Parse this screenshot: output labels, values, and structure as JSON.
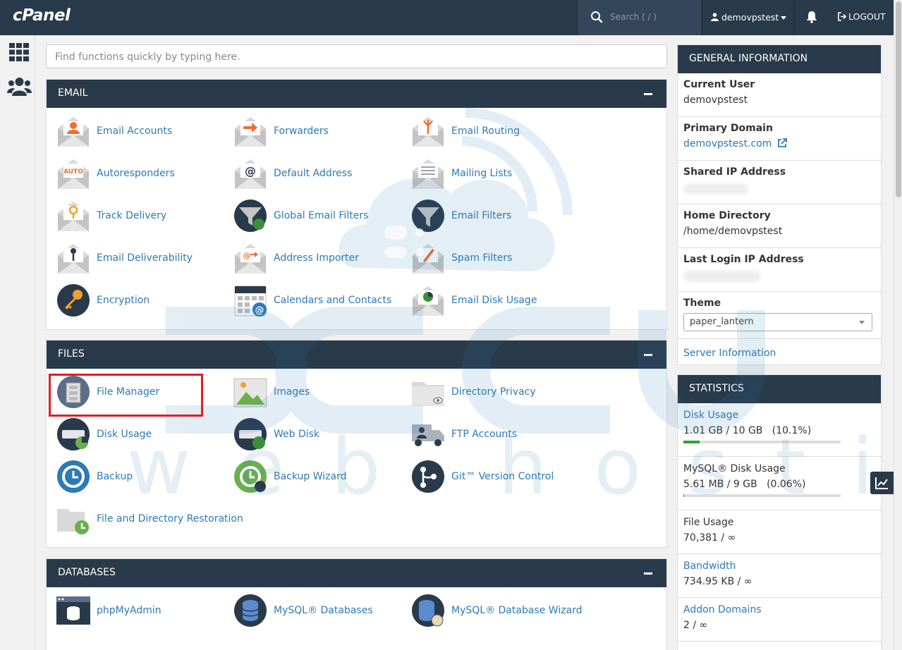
{
  "topbar": {
    "logo": "cPanel",
    "search_placeholder": "Search ( / )",
    "username": "demovpstest",
    "logout": "LOGOUT"
  },
  "quick_search": {
    "placeholder": "Find functions quickly by typing here."
  },
  "sections": {
    "email": {
      "title": "EMAIL",
      "items": [
        {
          "label": "Email Accounts",
          "icon": "email-accounts-icon"
        },
        {
          "label": "Forwarders",
          "icon": "forwarders-icon"
        },
        {
          "label": "Email Routing",
          "icon": "email-routing-icon"
        },
        {
          "label": "Autoresponders",
          "icon": "autoresponders-icon"
        },
        {
          "label": "Default Address",
          "icon": "default-address-icon"
        },
        {
          "label": "Mailing Lists",
          "icon": "mailing-lists-icon"
        },
        {
          "label": "Track Delivery",
          "icon": "track-delivery-icon"
        },
        {
          "label": "Global Email Filters",
          "icon": "global-email-filters-icon"
        },
        {
          "label": "Email Filters",
          "icon": "email-filters-icon"
        },
        {
          "label": "Email Deliverability",
          "icon": "email-deliverability-icon"
        },
        {
          "label": "Address Importer",
          "icon": "address-importer-icon"
        },
        {
          "label": "Spam Filters",
          "icon": "spam-filters-icon"
        },
        {
          "label": "Encryption",
          "icon": "encryption-icon"
        },
        {
          "label": "Calendars and Contacts",
          "icon": "calendars-icon"
        },
        {
          "label": "Email Disk Usage",
          "icon": "email-disk-usage-icon"
        }
      ]
    },
    "files": {
      "title": "FILES",
      "items": [
        {
          "label": "File Manager",
          "icon": "file-manager-icon"
        },
        {
          "label": "Images",
          "icon": "images-icon"
        },
        {
          "label": "Directory Privacy",
          "icon": "directory-privacy-icon"
        },
        {
          "label": "Disk Usage",
          "icon": "disk-usage-icon"
        },
        {
          "label": "Web Disk",
          "icon": "web-disk-icon"
        },
        {
          "label": "FTP Accounts",
          "icon": "ftp-accounts-icon"
        },
        {
          "label": "Backup",
          "icon": "backup-icon"
        },
        {
          "label": "Backup Wizard",
          "icon": "backup-wizard-icon"
        },
        {
          "label": "Git™ Version Control",
          "icon": "git-icon"
        },
        {
          "label": "File and Directory Restoration",
          "icon": "restoration-icon"
        }
      ]
    },
    "databases": {
      "title": "DATABASES",
      "items": [
        {
          "label": "phpMyAdmin",
          "icon": "phpmyadmin-icon"
        },
        {
          "label": "MySQL® Databases",
          "icon": "mysql-databases-icon"
        },
        {
          "label": "MySQL® Database Wizard",
          "icon": "mysql-wizard-icon"
        }
      ]
    }
  },
  "general_info": {
    "title": "GENERAL INFORMATION",
    "current_user_label": "Current User",
    "current_user": "demovpstest",
    "primary_domain_label": "Primary Domain",
    "primary_domain": "demovpstest.com",
    "shared_ip_label": "Shared IP Address",
    "home_dir_label": "Home Directory",
    "home_dir": "/home/demovpstest",
    "last_login_label": "Last Login IP Address",
    "theme_label": "Theme",
    "theme_value": "paper_lantern",
    "server_info": "Server Information"
  },
  "statistics": {
    "title": "STATISTICS",
    "disk_usage_label": "Disk Usage",
    "disk_usage_value": "1.01 GB / 10 GB   (10.1%)",
    "disk_usage_fraction": 0.101,
    "mysql_label": "MySQL® Disk Usage",
    "mysql_value": "5.61 MB / 9 GB   (0.06%)",
    "mysql_fraction": 0.0006,
    "file_usage_label": "File Usage",
    "file_usage_value": "70,381 / ∞",
    "bandwidth_label": "Bandwidth",
    "bandwidth_value": "734.95 KB / ∞",
    "addon_label": "Addon Domains",
    "addon_value": "2 / ∞"
  },
  "watermark": {
    "top": "accu",
    "bottom": "web hosting"
  },
  "colors": {
    "header": "#293a4a",
    "link": "#2e7ab5",
    "highlight": "#e21d24"
  }
}
